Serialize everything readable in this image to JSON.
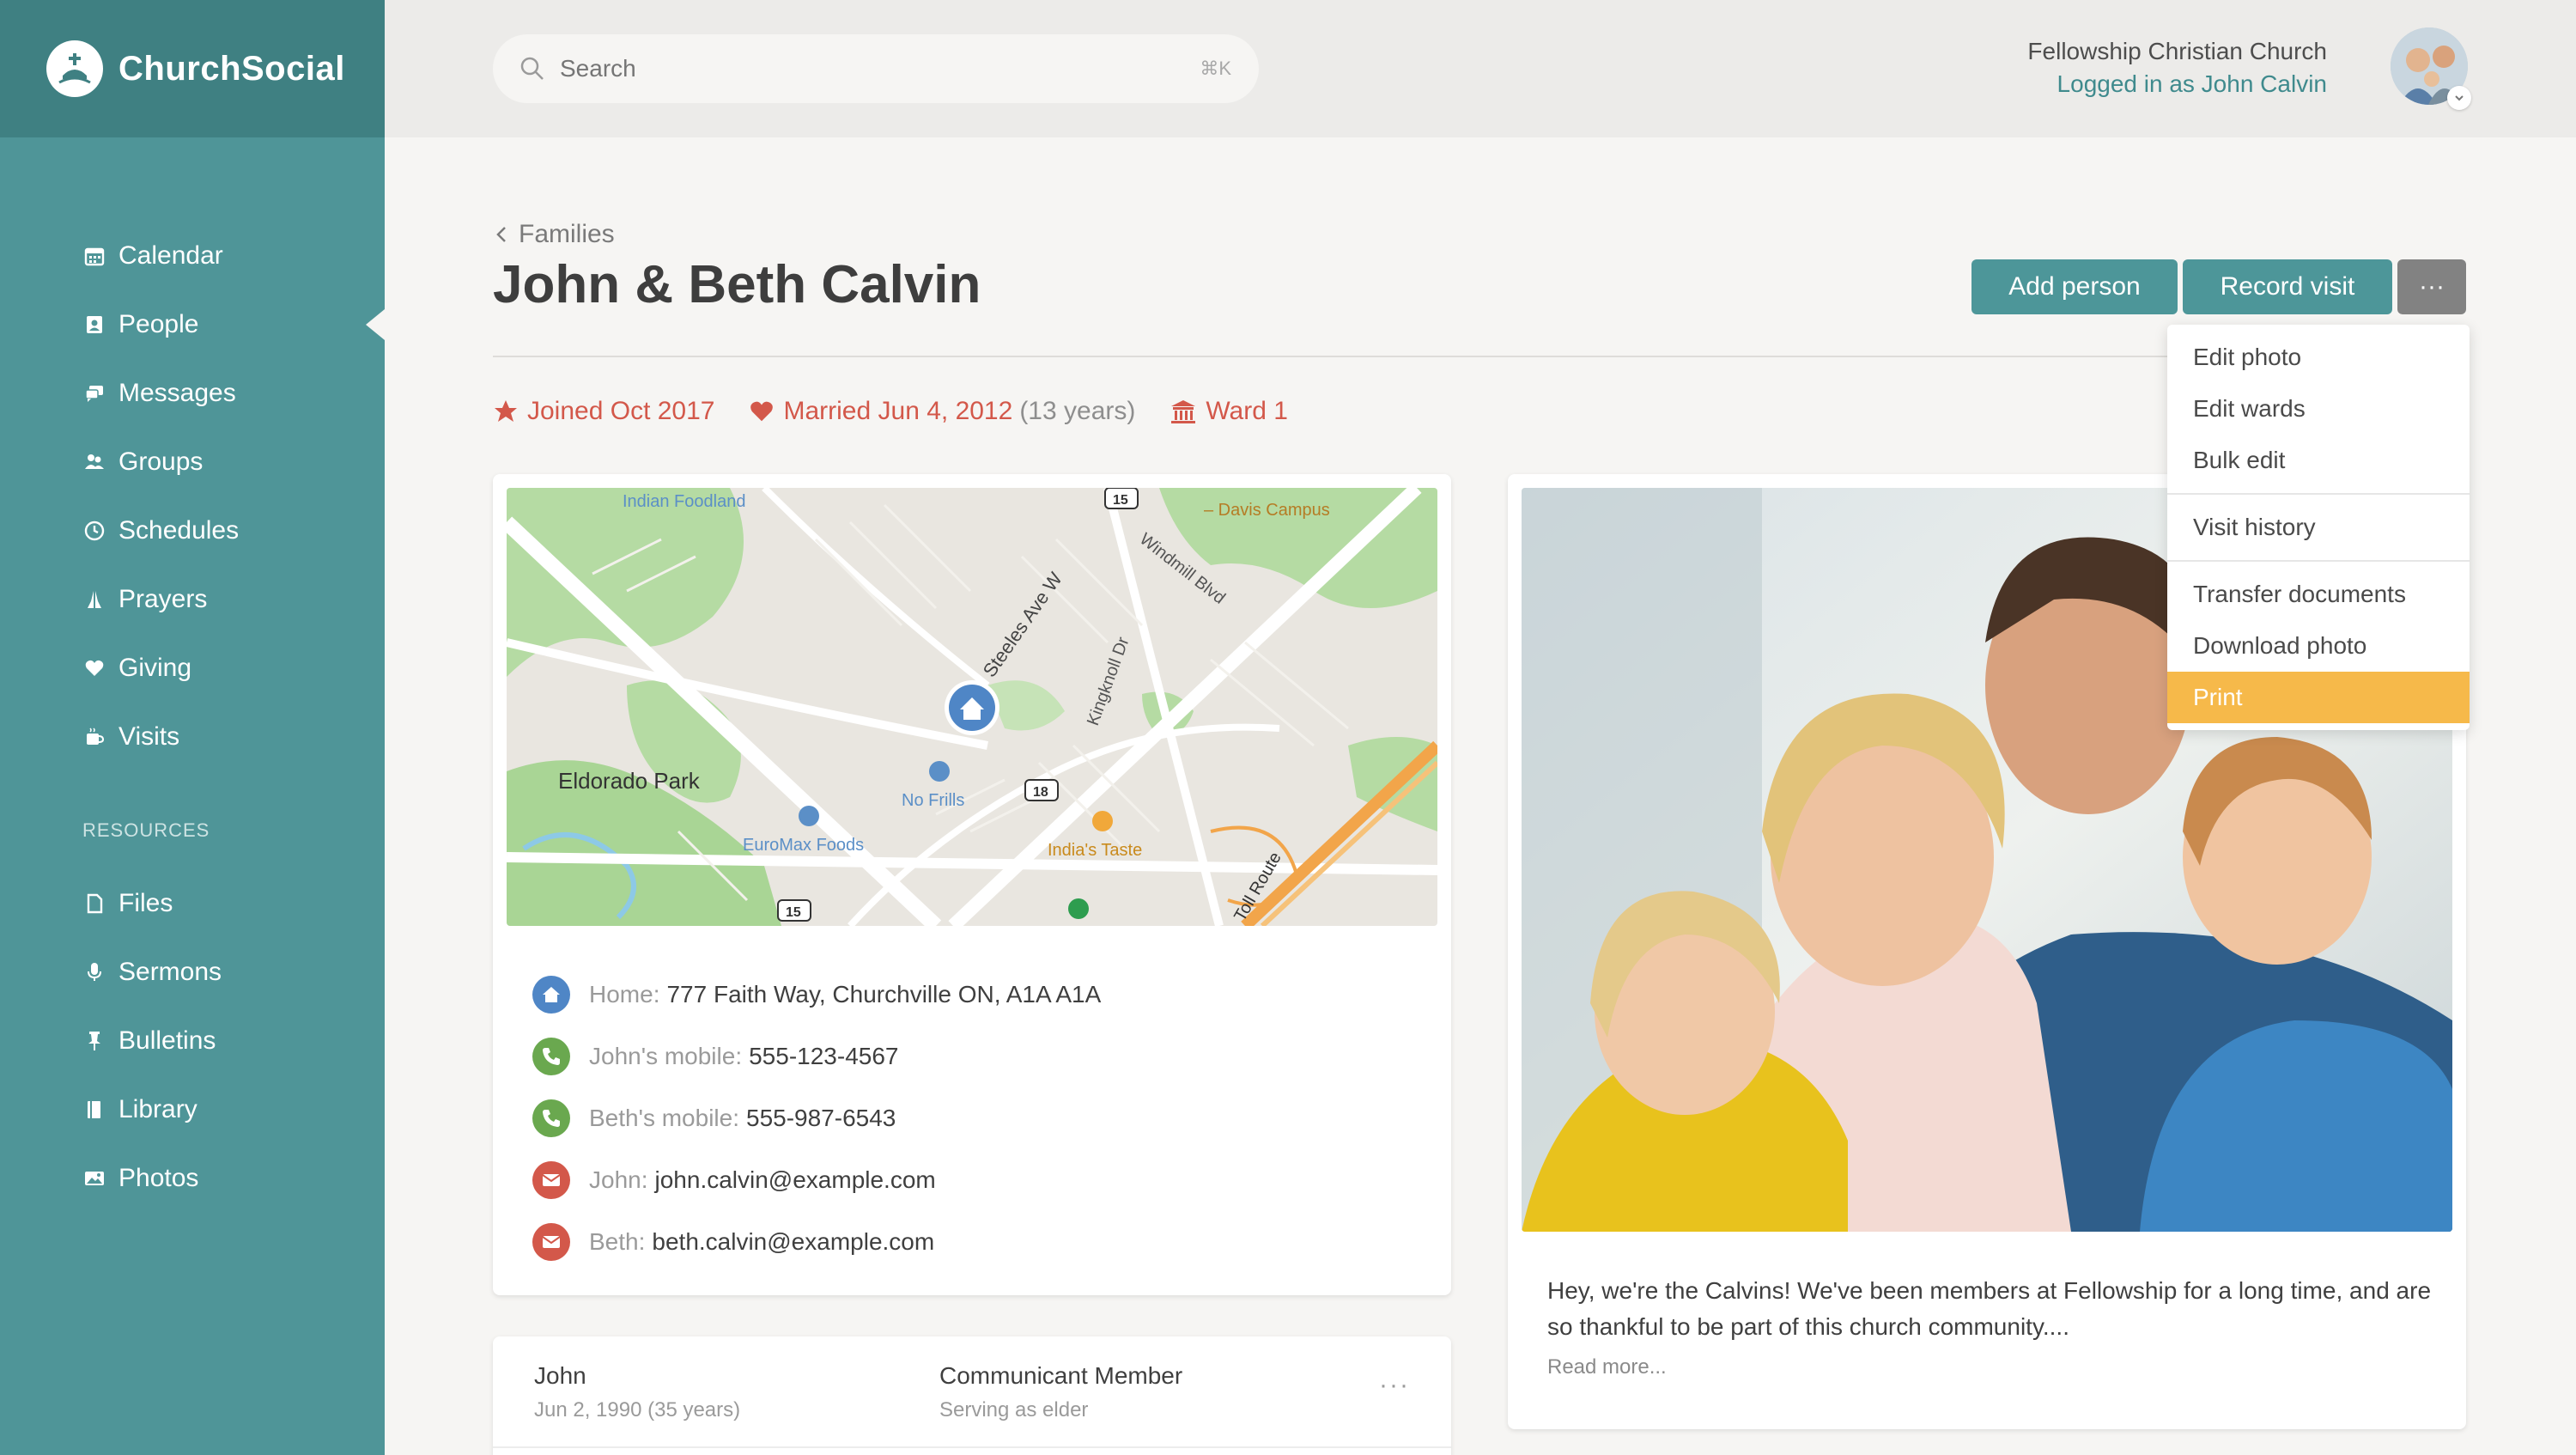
{
  "brand": {
    "name": "ChurchSocial"
  },
  "nav": {
    "items": [
      {
        "label": "Calendar",
        "icon": "calendar-icon"
      },
      {
        "label": "People",
        "icon": "people-icon",
        "active": true
      },
      {
        "label": "Messages",
        "icon": "messages-icon"
      },
      {
        "label": "Groups",
        "icon": "groups-icon"
      },
      {
        "label": "Schedules",
        "icon": "clock-icon"
      },
      {
        "label": "Prayers",
        "icon": "praying-hands-icon"
      },
      {
        "label": "Giving",
        "icon": "heart-icon"
      },
      {
        "label": "Visits",
        "icon": "coffee-icon"
      }
    ],
    "section_label": "RESOURCES",
    "resources": [
      {
        "label": "Files",
        "icon": "file-icon"
      },
      {
        "label": "Sermons",
        "icon": "microphone-icon"
      },
      {
        "label": "Bulletins",
        "icon": "pin-icon"
      },
      {
        "label": "Library",
        "icon": "book-icon"
      },
      {
        "label": "Photos",
        "icon": "photo-icon"
      }
    ]
  },
  "topbar": {
    "search_placeholder": "Search",
    "search_shortcut": "⌘K",
    "org": "Fellowship Christian Church",
    "logged_in": "Logged in as John Calvin"
  },
  "header": {
    "breadcrumb": "Families",
    "title": "John & Beth Calvin",
    "add_person": "Add person",
    "record_visit": "Record visit",
    "more": "···"
  },
  "meta": {
    "joined": "Joined Oct 2017",
    "married": "Married Jun 4, 2012",
    "married_years": "(13 years)",
    "ward": "Ward 1"
  },
  "map": {
    "labels": {
      "indian_foodland": "Indian Foodland",
      "davis_campus": "– Davis Campus",
      "windmill": "Windmill Blvd",
      "steeles": "Steeles Ave W",
      "kingknoll": "Kingknoll Dr",
      "eldorado": "Eldorado Park",
      "no_frills": "No Frills",
      "euromax": "EuroMax Foods",
      "indias_taste": "India's Taste",
      "toll_route": "Toll Route",
      "r15a": "15",
      "r15b": "15",
      "r18": "18"
    }
  },
  "contacts": [
    {
      "label": "Home:",
      "value": "777 Faith Way, Churchville ON, A1A A1A",
      "icon": "home-icon",
      "color": "#4f86c6"
    },
    {
      "label": "John's mobile:",
      "value": "555-123-4567",
      "icon": "phone-icon",
      "color": "#6aa84f"
    },
    {
      "label": "Beth's mobile:",
      "value": "555-987-6543",
      "icon": "phone-icon",
      "color": "#6aa84f"
    },
    {
      "label": "John:",
      "value": "john.calvin@example.com",
      "icon": "mail-icon",
      "color": "#d3584a"
    },
    {
      "label": "Beth:",
      "value": "beth.calvin@example.com",
      "icon": "mail-icon",
      "color": "#d3584a"
    }
  ],
  "member": {
    "name": "John",
    "dob": "Jun 2, 1990 (35 years)",
    "role": "Communicant Member",
    "serving": "Serving as elder",
    "more": "···"
  },
  "bio": {
    "text": "Hey, we're the Calvins! We've been members at Fellowship for a long time, and are so thankful to be part of this church community....",
    "read_more": "Read more..."
  },
  "menu": {
    "group1": [
      "Edit photo",
      "Edit wards",
      "Bulk edit"
    ],
    "group2": [
      "Visit history"
    ],
    "group3": [
      "Transfer documents",
      "Download photo",
      "Print"
    ],
    "highlighted": "Print"
  },
  "colors": {
    "sidebar": "#4f9598",
    "brand_bar": "#3f8082",
    "accent": "#4d9699",
    "meta_red": "#d3584a",
    "menu_highlight": "#f6b94a"
  }
}
